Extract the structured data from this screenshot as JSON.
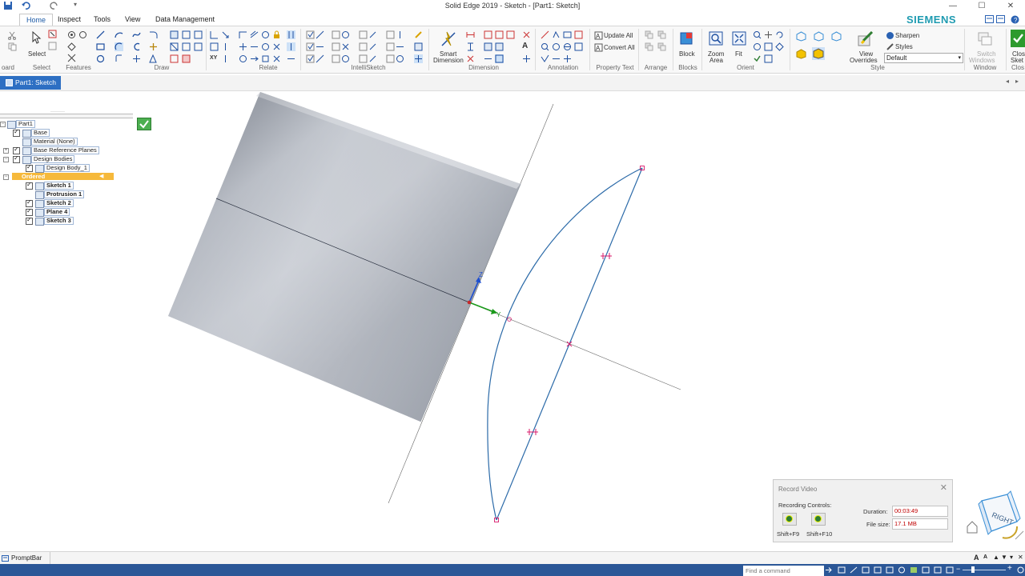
{
  "window": {
    "title": "Solid Edge 2019 - Sketch - [Part1: Sketch]",
    "brand": "SIEMENS"
  },
  "menu_tabs": [
    "Home",
    "Inspect",
    "Tools",
    "View",
    "Data Management"
  ],
  "ribbon": {
    "groups": [
      "oard",
      "Select",
      "Features",
      "Draw",
      "Relate",
      "IntelliSketch",
      "Dimension",
      "Annotation",
      "Property Text",
      "Arrange",
      "Blocks",
      "Orient",
      "Style",
      "Window",
      "Clos"
    ],
    "select_label": "Select",
    "smart_dimension_label_1": "Smart",
    "smart_dimension_label_2": "Dimension",
    "update_all": "Update All",
    "convert_all": "Convert All",
    "block_label": "Block",
    "zoom_area_1": "Zoom",
    "zoom_area_2": "Area",
    "fit_label": "Fit",
    "view_overrides_1": "View",
    "view_overrides_2": "Overrides",
    "sharpen": "Sharpen",
    "styles": "Styles",
    "style_value": "Default",
    "switch_windows_1": "Switch",
    "switch_windows_2": "Windows",
    "close_sketch_1": "Clos",
    "close_sketch_2": "Sket"
  },
  "doc_tab": "Part1: Sketch",
  "tree": {
    "items": [
      {
        "label": "Part1"
      },
      {
        "label": "Base"
      },
      {
        "label": "Material (None)"
      },
      {
        "label": "Base Reference Planes"
      },
      {
        "label": "Design Bodies"
      },
      {
        "label": "Design Body_1"
      },
      {
        "label": "Ordered"
      },
      {
        "label": "Sketch 1"
      },
      {
        "label": "Protrusion 1"
      },
      {
        "label": "Sketch 2"
      },
      {
        "label": "Plane 4"
      },
      {
        "label": "Sketch 3"
      }
    ]
  },
  "record_video": {
    "title": "Record Video",
    "controls_label": "Recording Controls:",
    "duration_label": "Duration:",
    "duration_value": "00:03:49",
    "filesize_label": "File size:",
    "filesize_value": "17.1 MB",
    "pause_shortcut": "Shift+F9",
    "stop_shortcut": "Shift+F10"
  },
  "view_cube_label": "RIGHT",
  "prompt_bar": "PromptBar",
  "status": {
    "find_placeholder": "Find a command"
  },
  "colors": {
    "accent": "#2d6fc3",
    "status_bar": "#2b5797",
    "brand": "#1f9bb1",
    "sketch_curve": "#2b6aa8",
    "constraint": "#d8186a"
  }
}
